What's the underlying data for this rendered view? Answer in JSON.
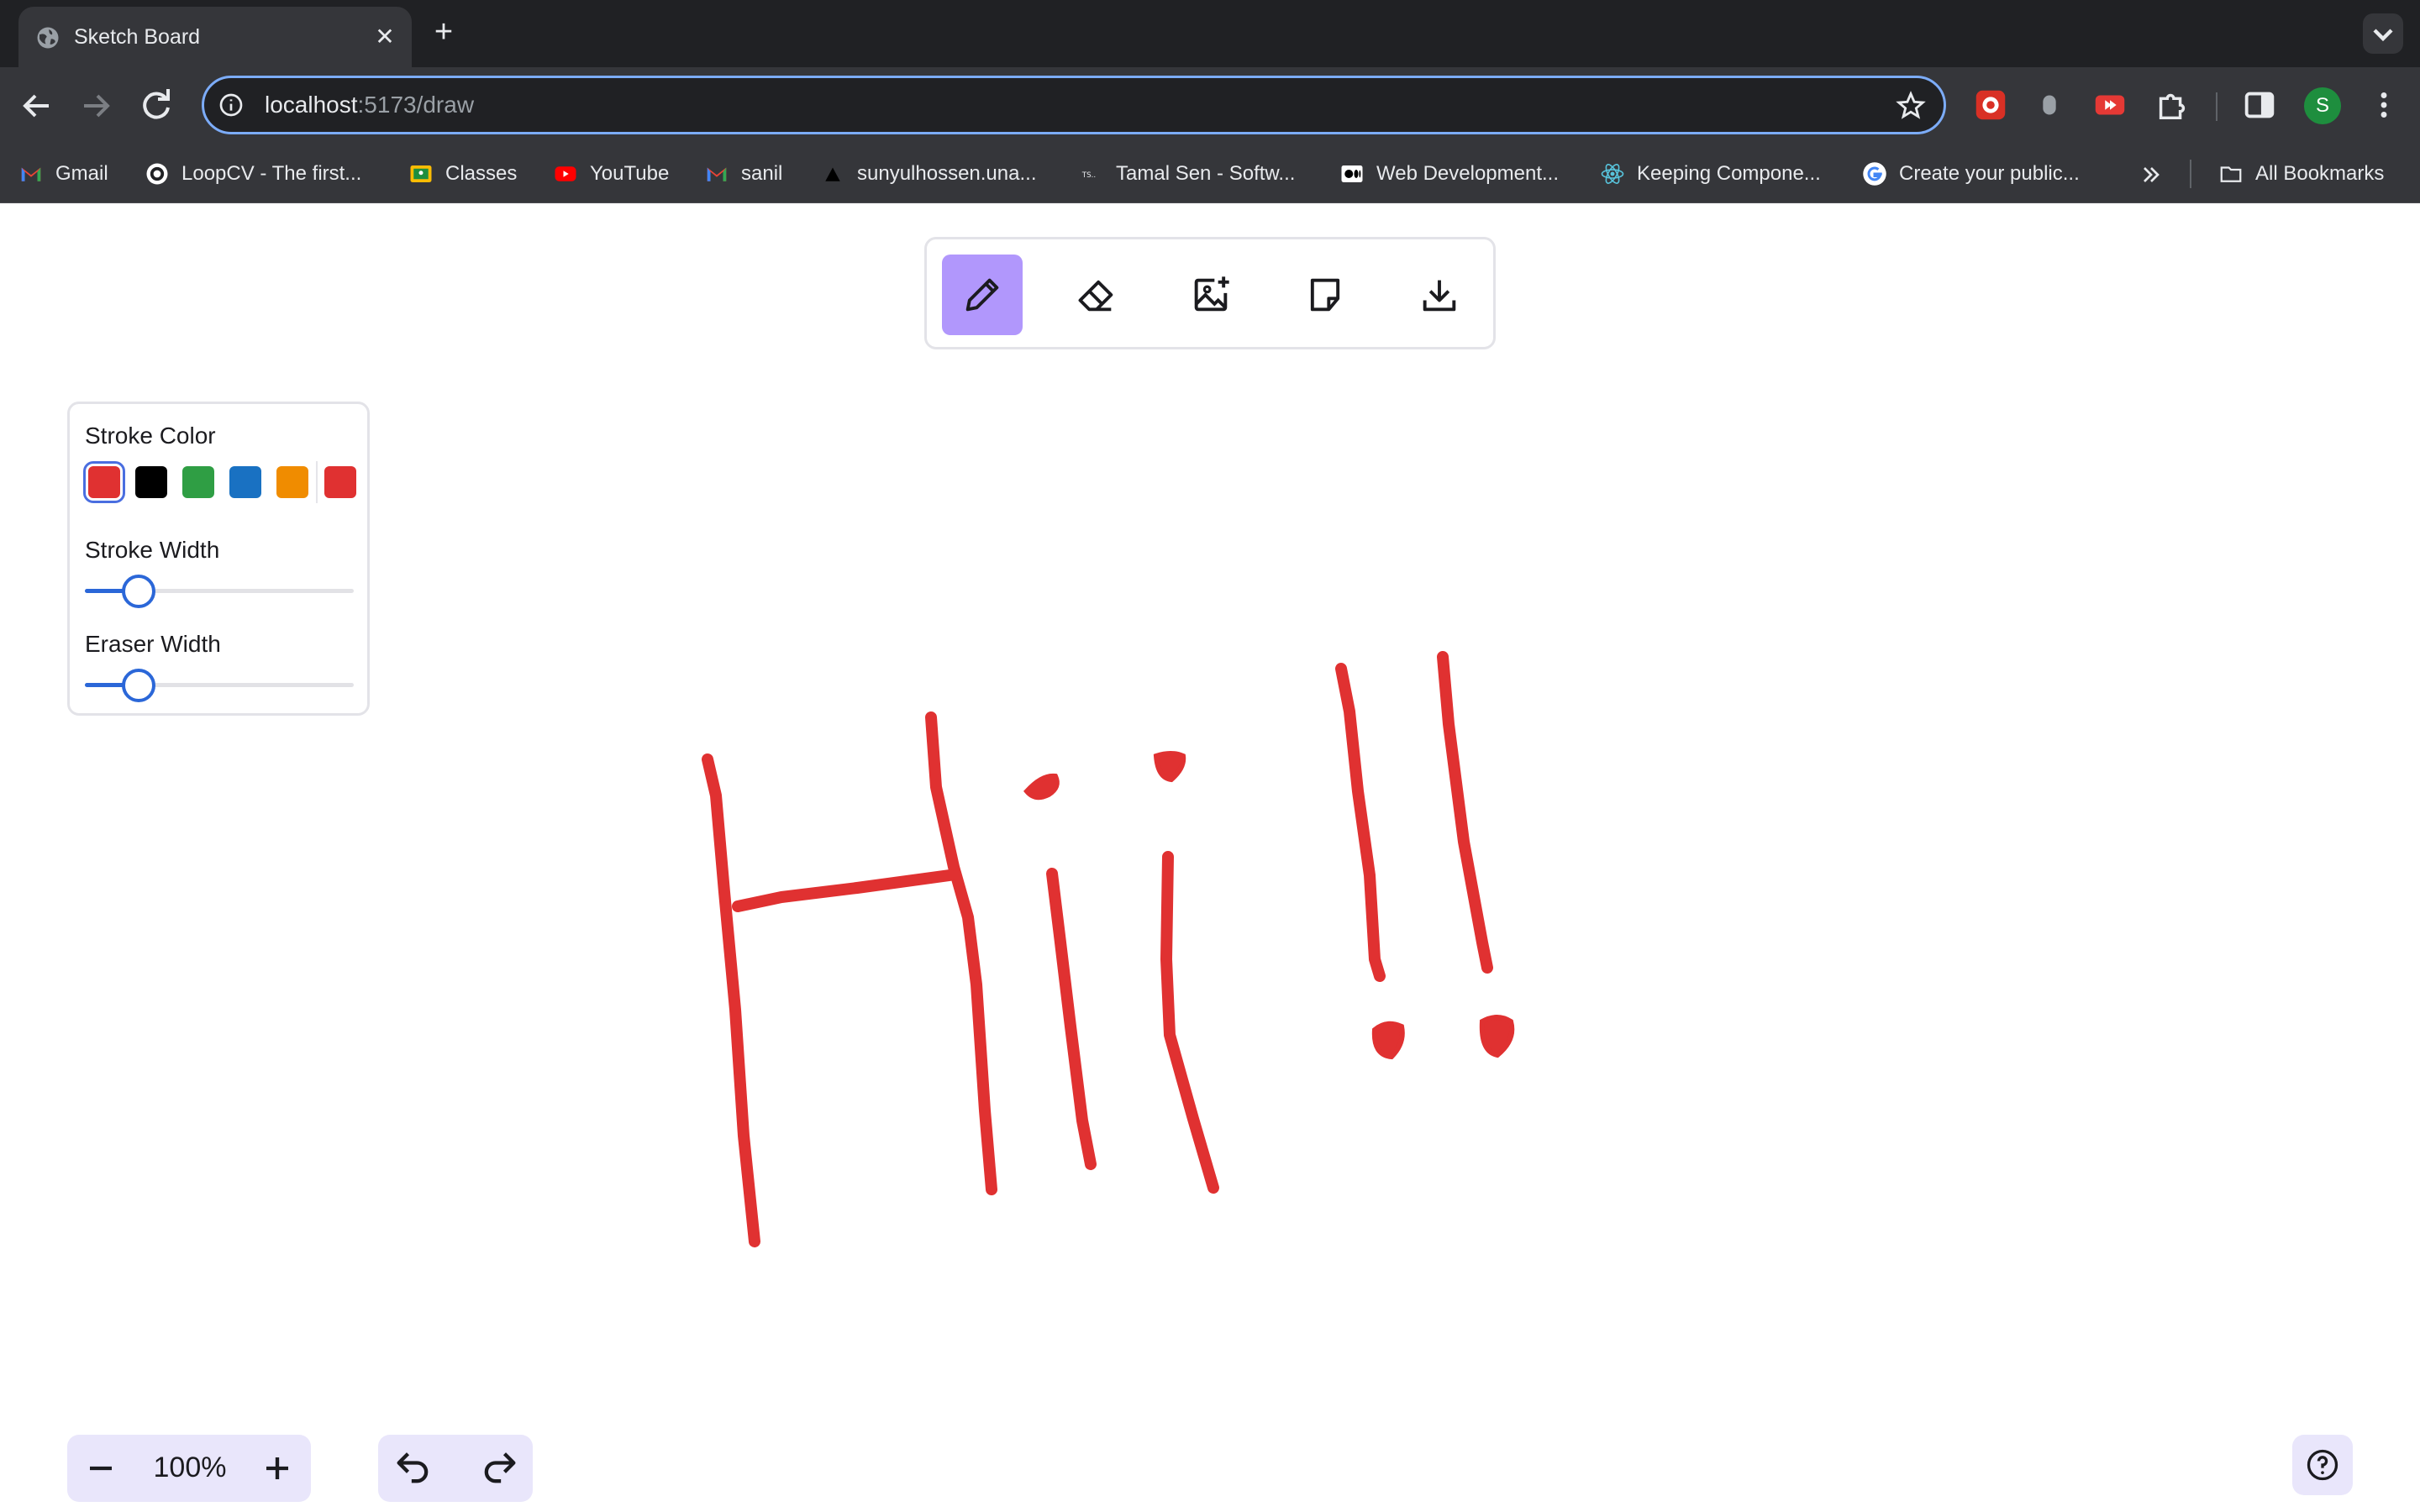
{
  "browser": {
    "tab_title": "Sketch Board",
    "url_host": "localhost",
    "url_path": ":5173/draw",
    "avatar_initial": "S",
    "bookmarks": [
      {
        "label": "Gmail",
        "icon": "gmail-icon"
      },
      {
        "label": "LoopCV - The first...",
        "icon": "loopcv-icon"
      },
      {
        "label": "Classes",
        "icon": "classroom-icon"
      },
      {
        "label": "YouTube",
        "icon": "youtube-icon"
      },
      {
        "label": "sanil",
        "icon": "gmail-icon"
      },
      {
        "label": "sunyulhossen.una...",
        "icon": "triangle-icon"
      },
      {
        "label": "Tamal Sen - Softw...",
        "icon": "ts-icon"
      },
      {
        "label": "Web Development...",
        "icon": "medium-icon"
      },
      {
        "label": "Keeping Compone...",
        "icon": "react-icon"
      },
      {
        "label": "Create your public...",
        "icon": "google-icon"
      }
    ],
    "all_bookmarks_label": "All Bookmarks"
  },
  "app": {
    "tools": [
      {
        "name": "pencil",
        "icon": "pencil-icon",
        "active": true
      },
      {
        "name": "eraser",
        "icon": "eraser-icon",
        "active": false
      },
      {
        "name": "add-image",
        "icon": "image-plus-icon",
        "active": false
      },
      {
        "name": "sticky-note",
        "icon": "sticky-note-icon",
        "active": false
      },
      {
        "name": "download",
        "icon": "download-icon",
        "active": false
      }
    ],
    "properties": {
      "stroke_color_label": "Stroke Color",
      "stroke_colors": [
        "#e03131",
        "#000000",
        "#2f9e44",
        "#1971c2",
        "#f08c00"
      ],
      "selected_color": "#e03131",
      "stroke_width_label": "Stroke Width",
      "stroke_width_level": 0.2,
      "eraser_width_label": "Eraser Width",
      "eraser_width_level": 0.2
    },
    "zoom_label": "100%",
    "stroke_color": "#e03131",
    "accent_color": "#b197fc"
  }
}
